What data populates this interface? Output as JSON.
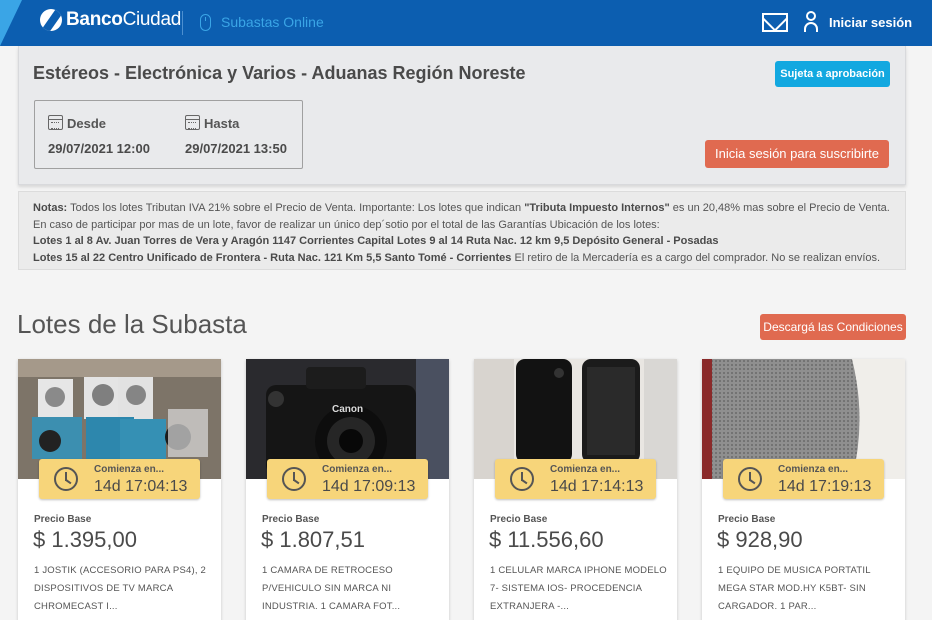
{
  "header": {
    "brand_bold": "Banco",
    "brand_regular": "Ciudad",
    "section": "Subastas Online",
    "login": "Iniciar sesión",
    "icons": [
      "mouse-icon",
      "mail-icon",
      "user-icon"
    ],
    "colors": {
      "bar": "#0c5eb0",
      "accent": "#3aa5e6"
    }
  },
  "auction": {
    "title": "Estéreos - Electrónica y Varios - Aduanas Región Noreste",
    "approval_badge": "Sujeta a aprobación",
    "from_label": "Desde",
    "from_value": "29/07/2021 12:00",
    "to_label": "Hasta",
    "to_value": "29/07/2021 13:50",
    "subscribe_button": "Inicia sesión para suscribirte"
  },
  "notes": {
    "l1a": "Notas:",
    "l1b": " Todos los lotes Tributan IVA 21% sobre el Precio de Venta. Importante: Los lotes que indican ",
    "l1c": "\"Tributa Impuesto Internos\"",
    "l1d": " es un 20,48% mas sobre el Precio de Venta",
    "l1e": ".",
    "l2": "En caso de participar por mas de un lote, favor de realizar un único dep´sotio por el total de las Garantías Ubicación de los lotes:",
    "l3": "Lotes 1 al 8   Av. Juan Torres de Vera y Aragón 1147 Corrientes Capital Lotes 9 al 14 Ruta Nac. 12 km 9,5 Depósito General  - Posadas",
    "l4a": "Lotes 15 al 22 Centro Unificado de Frontera - Ruta Nac. 121 Km 5,5 Santo Tomé - Corrientes",
    "l4b": " El retiro de la Mercadería es a cargo del comprador. No se realizan envíos."
  },
  "lots_section": {
    "title": "Lotes de la Subasta",
    "download_button": "Descargá las Condiciones"
  },
  "lots": [
    {
      "countdown_label": "Comienza en...",
      "countdown": "14d 17:04:13",
      "price_label": "Precio Base",
      "price": "$ 1.395,00",
      "description": "1 JOSTIK (ACCESORIO PARA PS4), 2 DISPOSITIVOS DE TV MARCA CHROMECAST I..."
    },
    {
      "countdown_label": "Comienza en...",
      "countdown": "14d 17:09:13",
      "price_label": "Precio Base",
      "price": "$ 1.807,51",
      "description": "1 CAMARA DE RETROCESO P/VEHICULO SIN MARCA NI INDUSTRIA. 1 CAMARA FOT...",
      "image_text": "Canon"
    },
    {
      "countdown_label": "Comienza en...",
      "countdown": "14d 17:14:13",
      "price_label": "Precio Base",
      "price": "$ 11.556,60",
      "description": "1 CELULAR MARCA IPHONE MODELO 7- SISTEMA IOS- PROCEDENCIA EXTRANJERA -..."
    },
    {
      "countdown_label": "Comienza en...",
      "countdown": "14d 17:19:13",
      "price_label": "Precio Base",
      "price": "$ 928,90",
      "description": "1 EQUIPO DE MUSICA PORTATIL MEGA STAR MOD.HY K5BT- SIN CARGADOR. 1 PAR..."
    }
  ]
}
